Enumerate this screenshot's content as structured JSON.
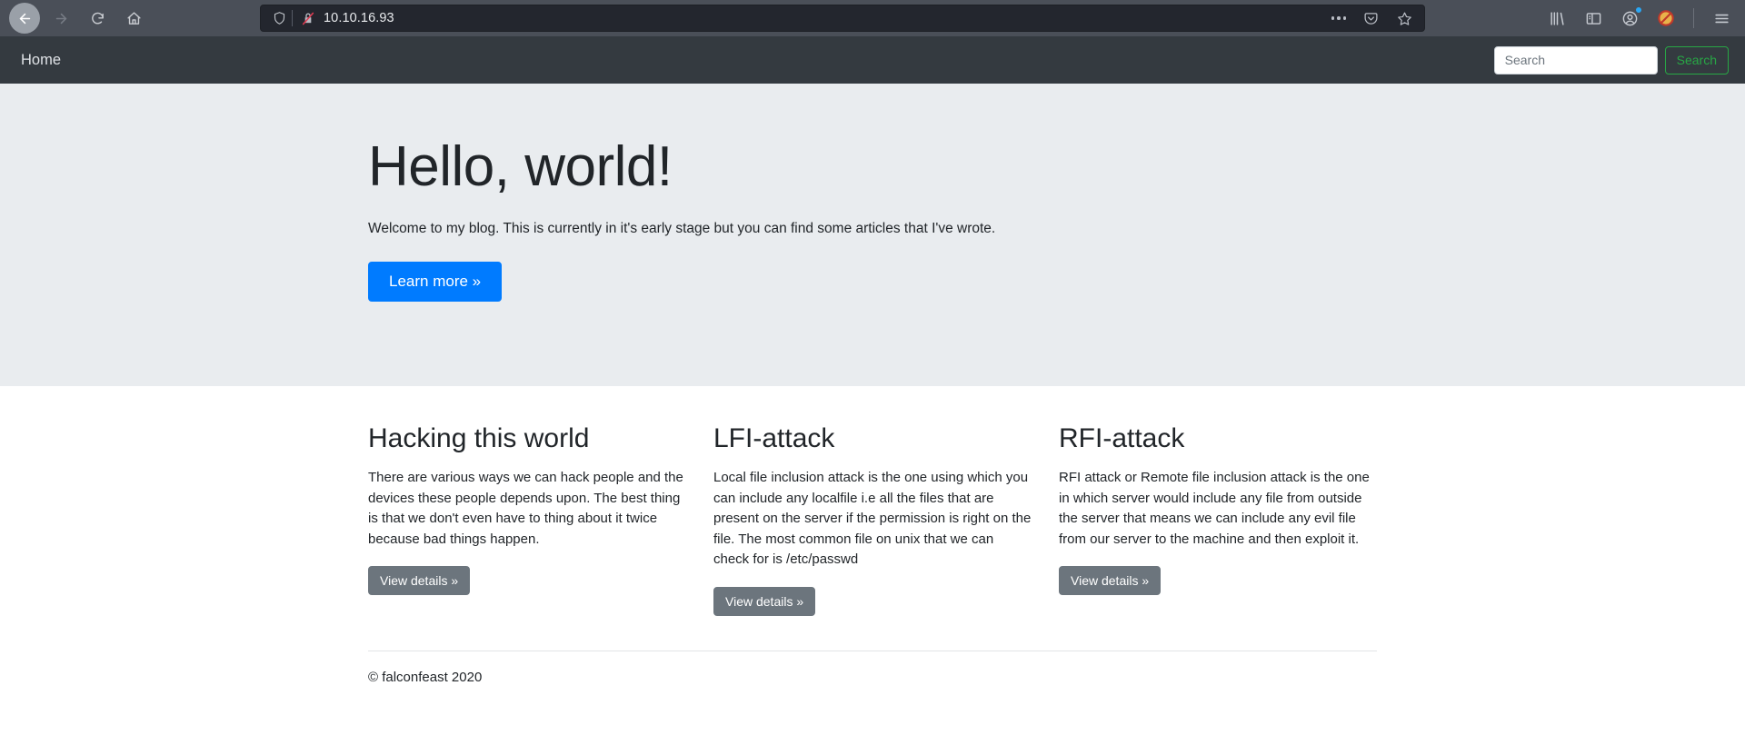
{
  "browser": {
    "back_label": "Back",
    "forward_label": "Forward",
    "reload_label": "Reload",
    "home_label": "Home",
    "url": "10.10.16.93",
    "shield_icon": "shield-icon",
    "insecure_icon": "broken-lock-icon",
    "page_actions_icon": "ellipsis-icon",
    "pocket_icon": "pocket-icon",
    "bookmark_icon": "star-icon",
    "library_icon": "library-icon",
    "sidebar_icon": "sidebar-icon",
    "account_icon": "account-icon",
    "noscript_icon": "noscript-blocked-icon",
    "menu_icon": "hamburger-menu-icon"
  },
  "navbar": {
    "brand": "Home",
    "search_placeholder": "Search",
    "search_value": "",
    "search_button": "Search"
  },
  "jumbotron": {
    "title": "Hello, world!",
    "lead": "Welcome to my blog. This is currently in it's early stage but you can find some articles that I've wrote.",
    "cta": "Learn more »"
  },
  "cards": [
    {
      "title": "Hacking this world",
      "text": "There are various ways we can hack people and the devices these people depends upon. The best thing is that we don't even have to thing about it twice because bad things happen.",
      "button": "View details »"
    },
    {
      "title": "LFI-attack",
      "text": "Local file inclusion attack is the one using which you can include any localfile i.e all the files that are present on the server if the permission is right on the file. The most common file on unix that we can check for is /etc/passwd",
      "button": "View details »"
    },
    {
      "title": "RFI-attack",
      "text": "RFI attack or Remote file inclusion attack is the one in which server would include any file from outside the server that means we can include any evil file from our server to the machine and then exploit it.",
      "button": "View details »"
    }
  ],
  "footer": {
    "copyright": "© falconfeast 2020"
  },
  "colors": {
    "navbar_bg": "#343a40",
    "jumbotron_bg": "#e9ecef",
    "primary": "#007bff",
    "secondary": "#6c757d",
    "success": "#28a745"
  }
}
